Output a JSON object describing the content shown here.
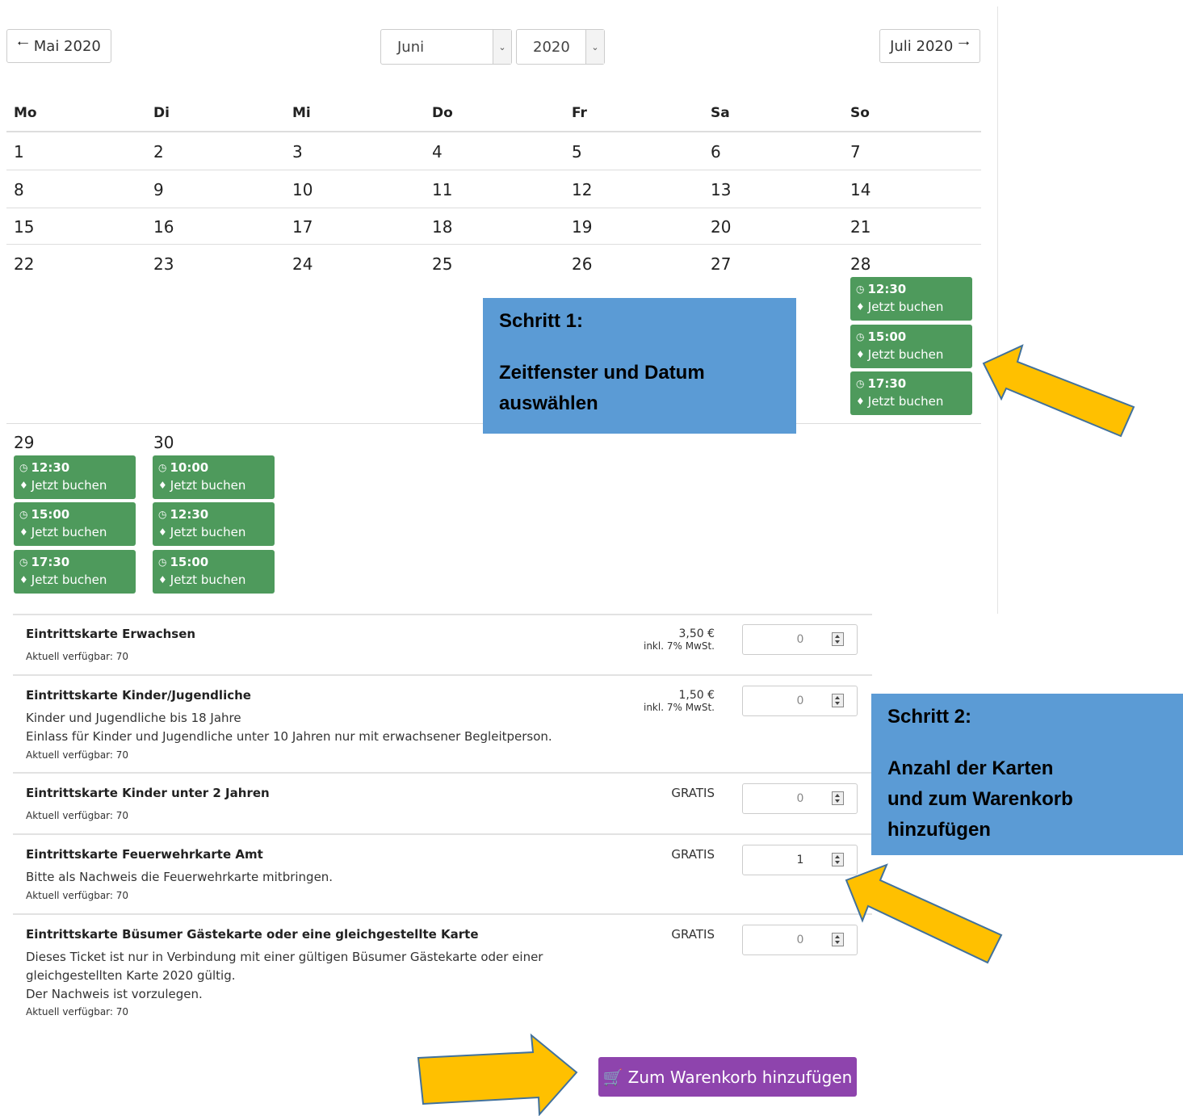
{
  "nav": {
    "prev": "Mai 2020",
    "next": "Juli 2020",
    "month": "Juni",
    "year": "2020"
  },
  "weekdays": [
    "Mo",
    "Di",
    "Mi",
    "Do",
    "Fr",
    "Sa",
    "So"
  ],
  "days": [
    "1",
    "2",
    "3",
    "4",
    "5",
    "6",
    "7",
    "8",
    "9",
    "10",
    "11",
    "12",
    "13",
    "14",
    "15",
    "16",
    "17",
    "18",
    "19",
    "20",
    "21",
    "22",
    "23",
    "24",
    "25",
    "26",
    "27",
    "28",
    "29",
    "30"
  ],
  "slots": {
    "book_label": "Jetzt buchen",
    "d28": [
      "12:30",
      "15:00",
      "17:30"
    ],
    "d29": [
      "12:30",
      "15:00",
      "17:30"
    ],
    "d30": [
      "10:00",
      "12:30",
      "15:00"
    ]
  },
  "callout1": {
    "title": "Schritt 1:",
    "line1": "Zeitfenster und Datum",
    "line2": "auswählen"
  },
  "callout2": {
    "title": "Schritt 2:",
    "line1": "Anzahl der Karten",
    "line2": "und zum Warenkorb",
    "line3": "hinzufügen"
  },
  "tickets": [
    {
      "name": "Eintrittskarte Erwachsen",
      "desc": [],
      "avail": "Aktuell verfügbar: 70",
      "price": "3,50 €",
      "vat": "inkl. 7% MwSt.",
      "qty": "0"
    },
    {
      "name": "Eintrittskarte Kinder/Jugendliche",
      "desc": [
        "Kinder und Jugendliche bis 18 Jahre",
        "Einlass für Kinder und Jugendliche unter 10 Jahren nur mit erwachsener Begleitperson."
      ],
      "avail": "Aktuell verfügbar: 70",
      "price": "1,50 €",
      "vat": "inkl. 7% MwSt.",
      "qty": "0"
    },
    {
      "name": "Eintrittskarte Kinder unter 2 Jahren",
      "desc": [],
      "avail": "Aktuell verfügbar: 70",
      "price": "GRATIS",
      "qty": "0"
    },
    {
      "name": "Eintrittskarte Feuerwehrkarte Amt",
      "desc": [
        "Bitte als Nachweis die Feuerwehrkarte mitbringen."
      ],
      "avail": "Aktuell verfügbar: 70",
      "price": "GRATIS",
      "qty": "1"
    },
    {
      "name": "Eintrittskarte Büsumer Gästekarte oder eine gleichgestellte Karte",
      "desc": [
        "Dieses Ticket ist nur in Verbindung mit einer gültigen Büsumer Gästekarte oder einer",
        "gleichgestellten Karte 2020 gültig.",
        "Der Nachweis ist vorzulegen."
      ],
      "avail": "Aktuell verfügbar: 70",
      "price": "GRATIS",
      "qty": "0"
    }
  ],
  "cart_label": "Zum Warenkorb hinzufügen",
  "colors": {
    "slot_green": "#4e9a5c",
    "callout_blue": "#5b9bd5",
    "arrow_orange": "#ffc000",
    "cart_purple": "#8e44ad"
  },
  "icons": [
    "arrow-left-icon",
    "arrow-right-icon",
    "clock-icon",
    "ticket-icon",
    "cart-icon",
    "spinner-icon"
  ]
}
